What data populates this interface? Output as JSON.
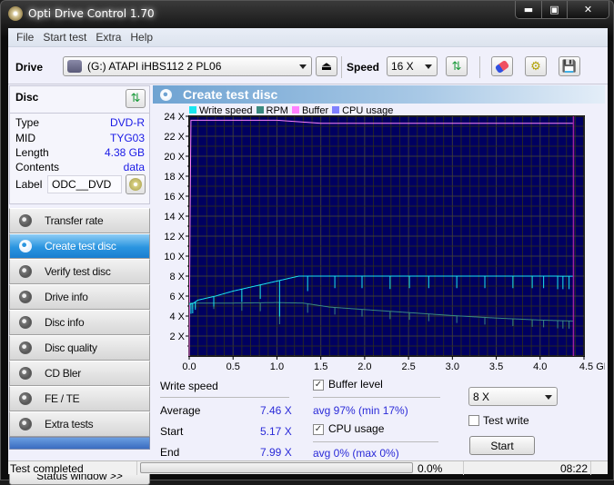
{
  "window": {
    "title": "Opti Drive Control 1.70",
    "controls": [
      "minimize",
      "maximize",
      "close"
    ]
  },
  "menu": [
    "File",
    "Start test",
    "Extra",
    "Help"
  ],
  "toolbar": {
    "drive_label": "Drive",
    "drive_value": "(G:)  ATAPI iHBS112  2 PL06",
    "speed_label": "Speed",
    "speed_value": "16 X"
  },
  "disc": {
    "header": "Disc",
    "rows": [
      {
        "k": "Type",
        "v": "DVD-R"
      },
      {
        "k": "MID",
        "v": "TYG03"
      },
      {
        "k": "Length",
        "v": "4.38 GB"
      },
      {
        "k": "Contents",
        "v": "data"
      }
    ],
    "label_key": "Label",
    "label_value": "ODC__DVD"
  },
  "nav": [
    {
      "label": "Transfer rate"
    },
    {
      "label": "Create test disc",
      "active": true
    },
    {
      "label": "Verify test disc"
    },
    {
      "label": "Drive info"
    },
    {
      "label": "Disc info"
    },
    {
      "label": "Disc quality"
    },
    {
      "label": "CD Bler"
    },
    {
      "label": "FE / TE"
    },
    {
      "label": "Extra tests"
    }
  ],
  "status_window_btn": "Status window >>",
  "main": {
    "title": "Create test disc"
  },
  "chart_data": {
    "type": "line",
    "title": "",
    "xlabel": "GB",
    "ylabel": "X",
    "xlim": [
      0,
      4.5
    ],
    "ylim": [
      0,
      24
    ],
    "x_ticks": [
      "0.0",
      "0.5",
      "1.0",
      "1.5",
      "2.0",
      "2.5",
      "3.0",
      "3.5",
      "4.0",
      "4.5 GB"
    ],
    "y_ticks": [
      "2 X",
      "4 X",
      "6 X",
      "8 X",
      "10 X",
      "12 X",
      "14 X",
      "16 X",
      "18 X",
      "20 X",
      "22 X",
      "24 X"
    ],
    "grid": true,
    "legend": [
      {
        "name": "Write speed",
        "color": "#19e6f0"
      },
      {
        "name": "RPM",
        "color": "#3a8a80"
      },
      {
        "name": "Buffer",
        "color": "#ff80ff"
      },
      {
        "name": "CPU usage",
        "color": "#8080ff"
      }
    ],
    "legend_position": "top",
    "background": "#000060",
    "end_marker_gb": 4.38,
    "series": [
      {
        "name": "Write speed",
        "x": [
          0,
          0.05,
          0.1,
          0.3,
          0.5,
          0.7,
          0.9,
          1.1,
          1.25,
          1.5,
          2.0,
          2.5,
          3.0,
          3.5,
          4.0,
          4.38
        ],
        "y": [
          5.17,
          5.3,
          5.6,
          6.0,
          6.5,
          6.9,
          7.3,
          7.7,
          8.0,
          8.0,
          8.0,
          8.0,
          8.0,
          8.0,
          8.0,
          7.99
        ],
        "dips": [
          0.02,
          0.04,
          0.07,
          0.28,
          0.6,
          0.81,
          1.03,
          1.35,
          1.66,
          1.97,
          2.29,
          2.51,
          2.73,
          3.05,
          3.37,
          3.69,
          3.91,
          4.04,
          4.2,
          4.26,
          4.33
        ],
        "dip_depth": [
          1.0,
          1.0,
          0.8,
          1.0,
          1.3,
          1.4,
          3.6,
          1.5,
          1.2,
          1.2,
          1.3,
          1.2,
          1.2,
          1.2,
          1.2,
          1.2,
          1.2,
          1.2,
          1.3,
          1.3,
          1.3
        ]
      },
      {
        "name": "RPM",
        "x": [
          0,
          0.1,
          0.5,
          1.0,
          1.3,
          1.6,
          2.0,
          2.5,
          3.0,
          3.5,
          4.0,
          4.38
        ],
        "y": [
          5.3,
          5.3,
          5.3,
          5.35,
          5.3,
          4.9,
          4.65,
          4.35,
          4.05,
          3.8,
          3.6,
          3.5
        ]
      },
      {
        "name": "Buffer",
        "x": [
          0,
          0.01,
          0.02,
          0.5,
          1.0,
          1.5,
          4.38
        ],
        "y": [
          0,
          14,
          23.6,
          23.6,
          23.6,
          23.3,
          23.3
        ]
      }
    ]
  },
  "stats": {
    "write_speed_label": "Write speed",
    "average_label": "Average",
    "average": "7.46 X",
    "start_label": "Start",
    "start": "5.17 X",
    "end_label": "End",
    "end": "7.99 X",
    "buffer_label": "Buffer level",
    "buffer_checked": true,
    "buffer_value": "avg 97% (min 17%)",
    "cpu_label": "CPU usage",
    "cpu_checked": true,
    "cpu_value": "avg 0% (max 0%)",
    "write_speed_select": "8 X",
    "test_write_label": "Test write",
    "test_write_checked": false,
    "start_button": "Start"
  },
  "statusbar": {
    "text": "Test completed",
    "progress_pct": 0.0,
    "progress_text": "0.0%",
    "time": "08:22"
  }
}
